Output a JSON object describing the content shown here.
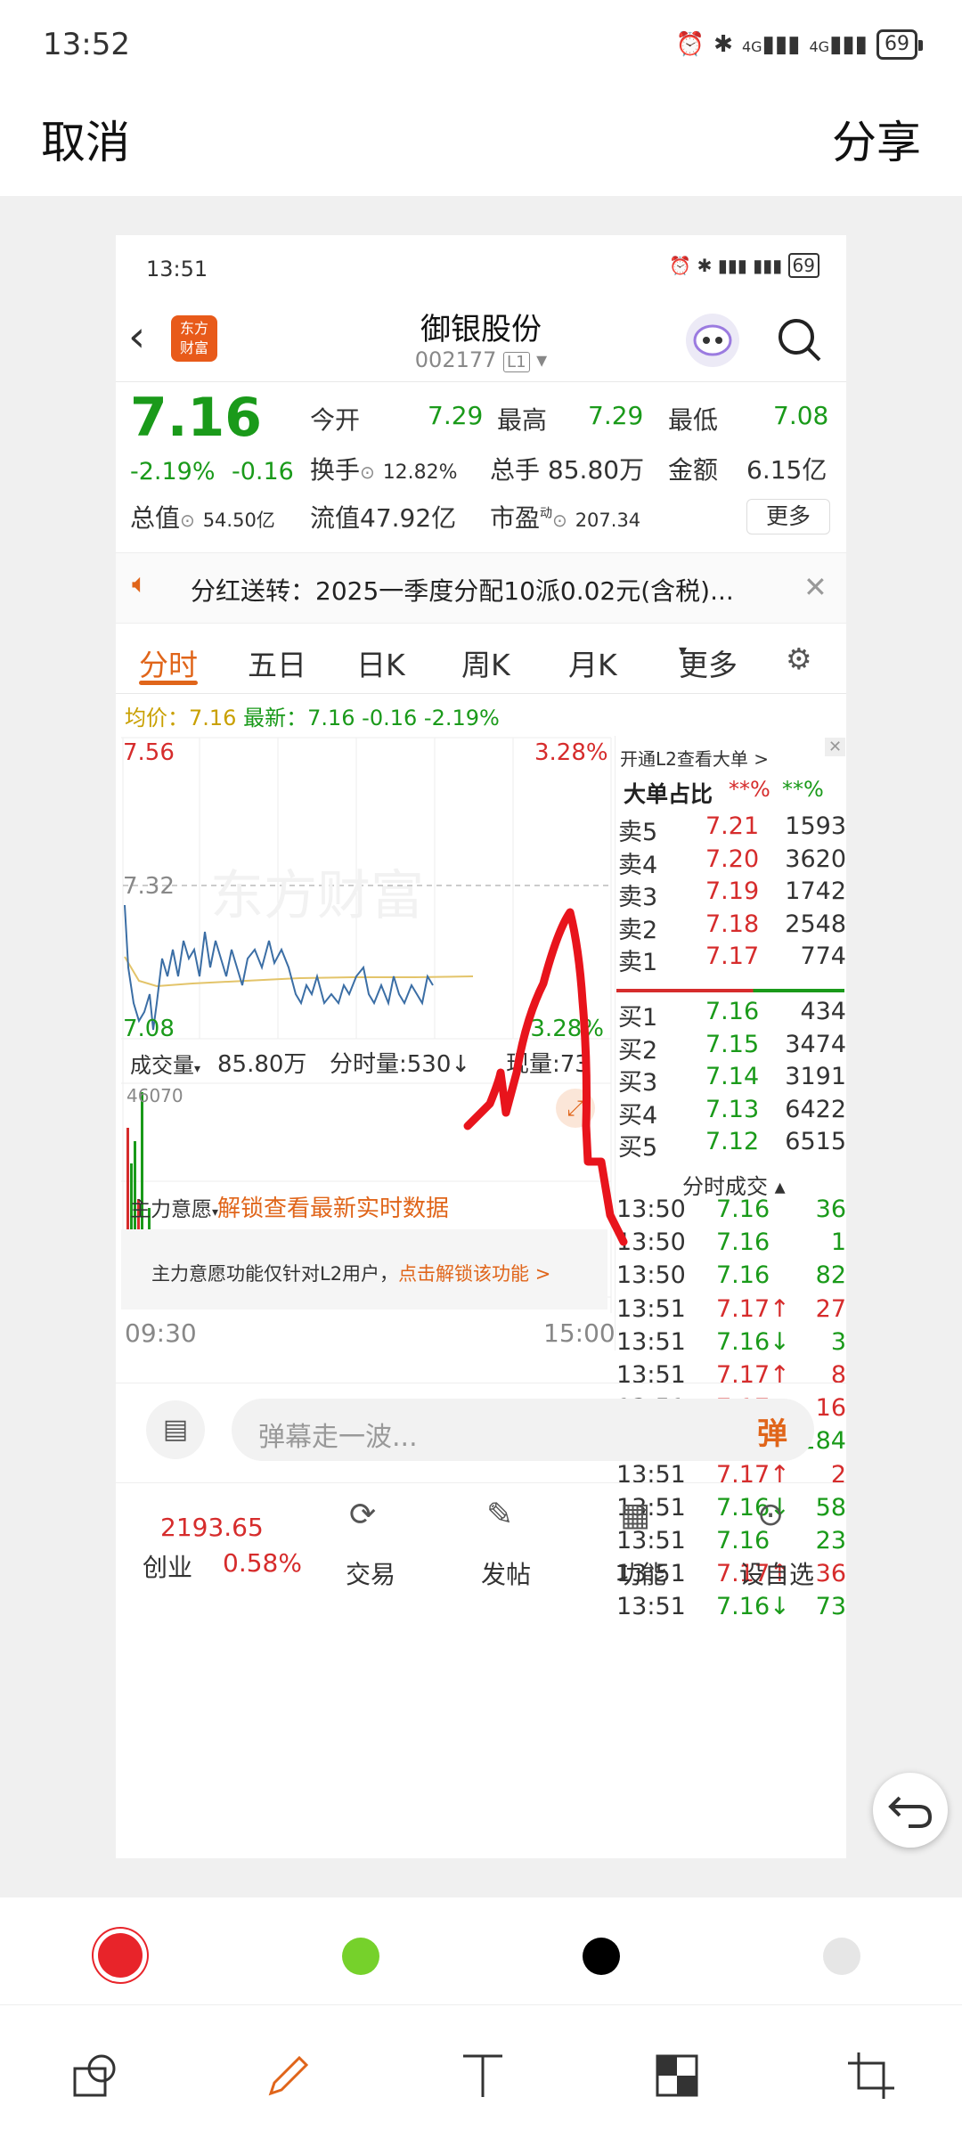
{
  "status_bar": {
    "time": "13:52",
    "battery": "69",
    "net1": "4G",
    "net2": "4G"
  },
  "top_bar": {
    "cancel": "取消",
    "share": "分享"
  },
  "shot": {
    "status": {
      "time": "13:51",
      "battery": "69"
    },
    "header": {
      "logo_top": "东方",
      "logo_bottom": "财富",
      "title": "御银股份",
      "code": "002177",
      "level": "L1"
    },
    "quote": {
      "price": "7.16",
      "pct": "-2.19%",
      "chg": "-0.16",
      "open_label": "今开",
      "open": "7.29",
      "high_label": "最高",
      "high": "7.29",
      "low_label": "最低",
      "low": "7.08",
      "turnover_label": "换手",
      "turnover": "12.82%",
      "vol_label": "总手",
      "vol": "85.80万",
      "amount_label": "金额",
      "amount": "6.15亿",
      "mcap_label": "总值",
      "mcap": "54.50亿",
      "float_label": "流值",
      "float": "47.92亿",
      "pe_label": "市盈",
      "pe_sup": "动",
      "pe": "207.34",
      "more": "更多"
    },
    "notice": "分红送转：2025一季度分配10派0.02元(含税)...",
    "tabs": [
      "分时",
      "五日",
      "日K",
      "周K",
      "月K",
      "更多"
    ],
    "avg_line": {
      "avg_label": "均价：",
      "avg": "7.16",
      "last_label": "最新：",
      "last": "7.16",
      "chg": "-0.16",
      "pct": "-2.19%"
    },
    "chart": {
      "top_price": "7.56",
      "top_pct": "3.28%",
      "mid_price": "7.32",
      "bottom_price": "7.08",
      "bottom_pct": "-3.28%",
      "watermark": "东方财富"
    },
    "volume_bar": {
      "label": "成交量",
      "total": "85.80万",
      "minute_label": "分时量:530↓",
      "now_label": "现量:73",
      "max": "46070"
    },
    "main_force": {
      "label": "主力意愿",
      "unlock": "解锁查看最新实时数据",
      "desc": "主力意愿功能仅针对L2用户，",
      "desc_link": "点击解锁该功能 >"
    },
    "axis": {
      "start": "09:30",
      "end": "15:00"
    },
    "order_book": {
      "open_l2": "开通L2查看大单 >",
      "big_label": "大单占比",
      "big_a": "**%",
      "big_b": "**%",
      "asks": [
        {
          "label": "卖5",
          "price": "7.21",
          "vol": "1593"
        },
        {
          "label": "卖4",
          "price": "7.20",
          "vol": "3620"
        },
        {
          "label": "卖3",
          "price": "7.19",
          "vol": "1742"
        },
        {
          "label": "卖2",
          "price": "7.18",
          "vol": "2548"
        },
        {
          "label": "卖1",
          "price": "7.17",
          "vol": "774"
        }
      ],
      "bids": [
        {
          "label": "买1",
          "price": "7.16",
          "vol": "434"
        },
        {
          "label": "买2",
          "price": "7.15",
          "vol": "3474"
        },
        {
          "label": "买3",
          "price": "7.14",
          "vol": "3191"
        },
        {
          "label": "买4",
          "price": "7.13",
          "vol": "6422"
        },
        {
          "label": "买5",
          "price": "7.12",
          "vol": "6515"
        }
      ],
      "trades_label": "分时成交",
      "trades": [
        {
          "time": "13:50",
          "price": "7.16",
          "dir": "",
          "vol": "36"
        },
        {
          "time": "13:50",
          "price": "7.16",
          "dir": "",
          "vol": "1"
        },
        {
          "time": "13:50",
          "price": "7.16",
          "dir": "",
          "vol": "82"
        },
        {
          "time": "13:51",
          "price": "7.17",
          "dir": "↑",
          "vol": "27"
        },
        {
          "time": "13:51",
          "price": "7.16",
          "dir": "↓",
          "vol": "3"
        },
        {
          "time": "13:51",
          "price": "7.17",
          "dir": "↑",
          "vol": "8"
        },
        {
          "time": "13:51",
          "price": "7.17",
          "dir": "",
          "vol": "16"
        },
        {
          "time": "13:51",
          "price": "7.16",
          "dir": "↓",
          "vol": "284"
        },
        {
          "time": "13:51",
          "price": "7.17",
          "dir": "↑",
          "vol": "2"
        },
        {
          "time": "13:51",
          "price": "7.16",
          "dir": "↓",
          "vol": "58"
        },
        {
          "time": "13:51",
          "price": "7.16",
          "dir": "",
          "vol": "23"
        },
        {
          "time": "13:51",
          "price": "7.17",
          "dir": "↑",
          "vol": "36"
        },
        {
          "time": "13:51",
          "price": "7.16",
          "dir": "↓",
          "vol": "73"
        }
      ]
    },
    "comment": {
      "placeholder": "弹幕走一波...",
      "danmu": "弹"
    },
    "bottom_nav": {
      "index_value": "2193.65",
      "index_name": "创业",
      "index_pct": "0.58%",
      "trade": "交易",
      "post": "发帖",
      "func": "功能",
      "watch": "设自选"
    }
  },
  "colors": {
    "red": "#e8242a",
    "green": "#76d12b",
    "black": "#000000",
    "light": "#e6e6e6",
    "accent": "#e0651a"
  }
}
